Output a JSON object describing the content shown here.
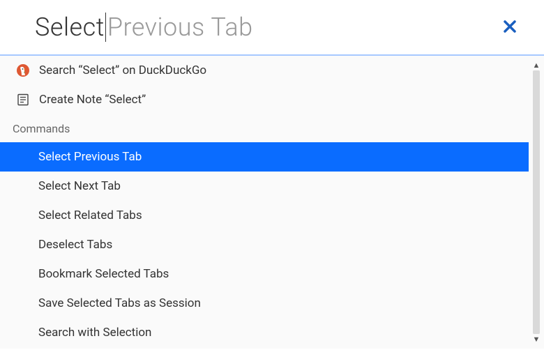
{
  "search": {
    "typed": "Select",
    "ghost": " Previous Tab"
  },
  "quick_actions": {
    "search_engine": "Search “Select” on DuckDuckGo",
    "create_note": "Create Note “Select”"
  },
  "section_header": "Commands",
  "commands": [
    "Select Previous Tab",
    "Select Next Tab",
    "Select Related Tabs",
    "Deselect Tabs",
    "Bookmark Selected Tabs",
    "Save Selected Tabs as Session",
    "Search with Selection"
  ],
  "selected_index": 0,
  "colors": {
    "highlight": "#0a6cff",
    "accent_divider": "#a6c8ff",
    "close_x": "#1a5fbf"
  }
}
